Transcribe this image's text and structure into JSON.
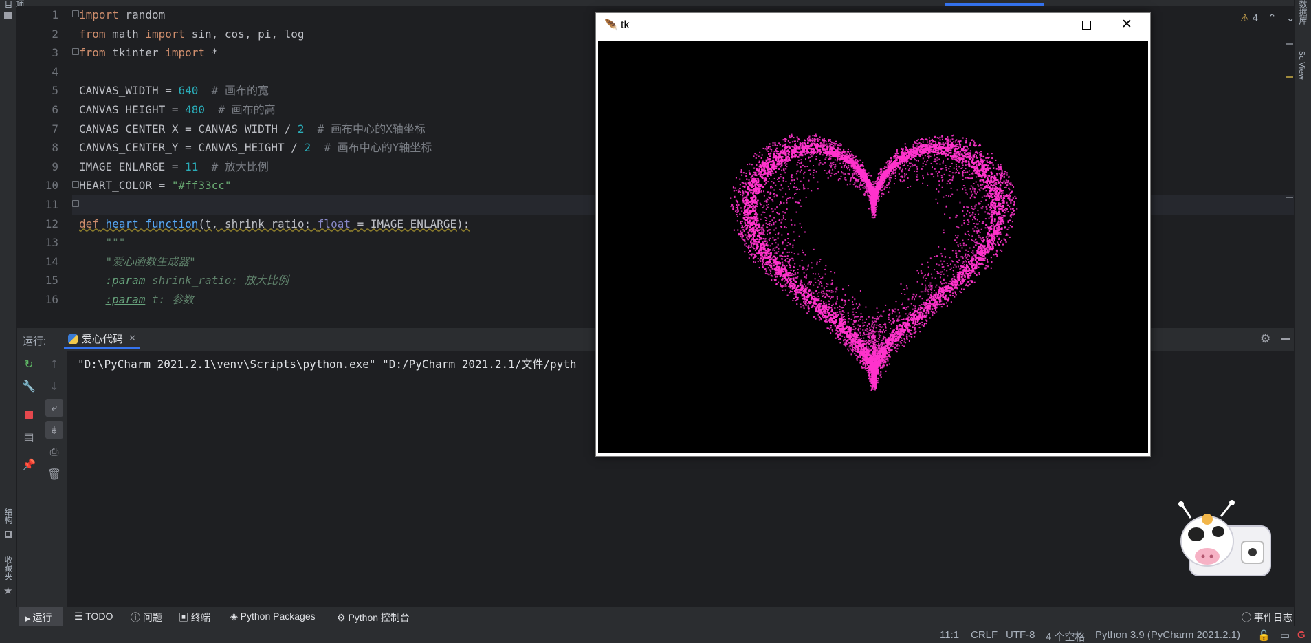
{
  "editor": {
    "line_numbers": [
      "1",
      "2",
      "3",
      "4",
      "5",
      "6",
      "7",
      "8",
      "9",
      "10",
      "11",
      "12",
      "13",
      "14",
      "15",
      "16"
    ],
    "lines": [
      {
        "t": [
          [
            "kw",
            "import"
          ],
          [
            "p",
            " random"
          ]
        ]
      },
      {
        "t": [
          [
            "kw",
            "from"
          ],
          [
            "p",
            " math "
          ],
          [
            "kw",
            "import"
          ],
          [
            "p",
            " sin, cos, pi, log"
          ]
        ]
      },
      {
        "t": [
          [
            "kw",
            "from"
          ],
          [
            "p",
            " tkinter "
          ],
          [
            "kw",
            "import"
          ],
          [
            "p",
            " *"
          ]
        ]
      },
      {
        "t": []
      },
      {
        "t": [
          [
            "p",
            "CANVAS_WIDTH = "
          ],
          [
            "num",
            "640"
          ],
          [
            "cmt",
            "  # 画布的宽"
          ]
        ]
      },
      {
        "t": [
          [
            "p",
            "CANVAS_HEIGHT = "
          ],
          [
            "num",
            "480"
          ],
          [
            "cmt",
            "  # 画布的高"
          ]
        ]
      },
      {
        "t": [
          [
            "p",
            "CANVAS_CENTER_X = CANVAS_WIDTH / "
          ],
          [
            "num",
            "2"
          ],
          [
            "cmt",
            "  # 画布中心的X轴坐标"
          ]
        ]
      },
      {
        "t": [
          [
            "p",
            "CANVAS_CENTER_Y = CANVAS_HEIGHT / "
          ],
          [
            "num",
            "2"
          ],
          [
            "cmt",
            "  # 画布中心的Y轴坐标"
          ]
        ]
      },
      {
        "t": [
          [
            "p",
            "IMAGE_ENLARGE = "
          ],
          [
            "num",
            "11"
          ],
          [
            "cmt",
            "  # 放大比例"
          ]
        ]
      },
      {
        "t": [
          [
            "p",
            "HEART_COLOR = "
          ],
          [
            "str",
            "\"#ff33cc\""
          ]
        ]
      },
      {
        "t": []
      },
      {
        "t": [
          [
            "kw",
            "def"
          ],
          [
            "p",
            " "
          ],
          [
            "fn",
            "heart_function"
          ],
          [
            "p",
            "(t, shrink_ratio: "
          ],
          [
            "type",
            "float"
          ],
          [
            "p",
            " = IMAGE_ENLARGE):"
          ]
        ]
      },
      {
        "t": [
          [
            "doc",
            "    \"\"\""
          ]
        ]
      },
      {
        "t": [
          [
            "doc",
            "    \"爱心函数生成器\""
          ]
        ]
      },
      {
        "t": [
          [
            "doc",
            "    "
          ],
          [
            "docu",
            ":param"
          ],
          [
            "doc",
            " shrink_ratio: 放大比例"
          ]
        ]
      },
      {
        "t": [
          [
            "doc",
            "    "
          ],
          [
            "docu",
            ":param"
          ],
          [
            "doc",
            " t: 参数"
          ]
        ]
      }
    ],
    "inspection": "4"
  },
  "run_panel": {
    "label": "运行:",
    "tab_label": "爱心代码",
    "console_text": "\"D:\\PyCharm 2021.2.1\\venv\\Scripts\\python.exe\" \"D:/PyCharm 2021.2.1/文件/pyth"
  },
  "bottom_tools": {
    "run": "运行",
    "todo": "TODO",
    "problems": "问题",
    "terminal": "终端",
    "packages": "Python Packages",
    "console": "Python 控制台",
    "event_log": "事件日志"
  },
  "status_bar": {
    "position": "11:1",
    "line_sep": "CRLF",
    "encoding": "UTF-8",
    "indent": "4 个空格",
    "interpreter": "Python 3.9 (PyCharm 2021.2.1)"
  },
  "left_stripe": {
    "project": "项目",
    "structure": "结构",
    "favorites": "收藏夹"
  },
  "right_stripe": {
    "database": "数据库",
    "sciview": "SciView"
  },
  "tk_window": {
    "title": "tk",
    "heart_color": "#ff33cc",
    "background": "#000000"
  },
  "colors": {
    "accent": "#3574f0",
    "stop": "#e5484d",
    "rerun": "#5fb865"
  }
}
